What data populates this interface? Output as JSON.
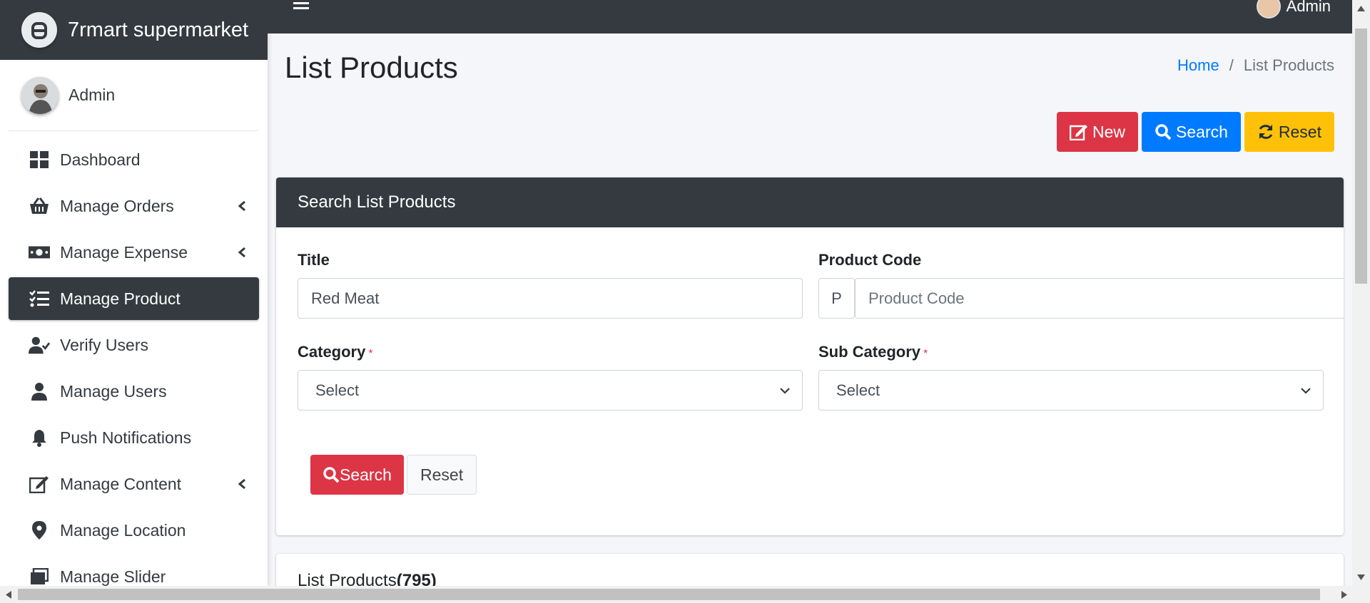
{
  "brand": {
    "name": "7rmart supermarket"
  },
  "sidebar": {
    "user_name": "Admin",
    "items": [
      {
        "label": "Dashboard",
        "icon": "dashboard-icon",
        "has_chevron": false,
        "active": false
      },
      {
        "label": "Manage Orders",
        "icon": "basket-icon",
        "has_chevron": true,
        "active": false
      },
      {
        "label": "Manage Expense",
        "icon": "money-icon",
        "has_chevron": true,
        "active": false
      },
      {
        "label": "Manage Product",
        "icon": "list-check-icon",
        "has_chevron": false,
        "active": true
      },
      {
        "label": "Verify Users",
        "icon": "user-check-icon",
        "has_chevron": false,
        "active": false
      },
      {
        "label": "Manage Users",
        "icon": "user-icon",
        "has_chevron": false,
        "active": false
      },
      {
        "label": "Push Notifications",
        "icon": "bell-icon",
        "has_chevron": false,
        "active": false
      },
      {
        "label": "Manage Content",
        "icon": "edit-icon",
        "has_chevron": true,
        "active": false
      },
      {
        "label": "Manage Location",
        "icon": "map-marker-icon",
        "has_chevron": false,
        "active": false
      },
      {
        "label": "Manage Slider",
        "icon": "slider-icon",
        "has_chevron": false,
        "active": false
      }
    ]
  },
  "topbar": {
    "user_name": "Admin"
  },
  "page": {
    "title": "List Products",
    "breadcrumb": {
      "home": "Home",
      "separator": "/",
      "current": "List Products"
    }
  },
  "actions": {
    "new_label": "New",
    "search_label": "Search",
    "reset_label": "Reset"
  },
  "search_card": {
    "header": "Search List Products",
    "title_label": "Title",
    "title_value": "Red Meat",
    "product_code_label": "Product Code",
    "product_code_prefix": "P",
    "product_code_placeholder": "Product Code",
    "category_label": "Category",
    "category_value": "Select",
    "subcategory_label": "Sub Category",
    "subcategory_value": "Select",
    "required_mark": "*",
    "search_button": "Search",
    "reset_button": "Reset"
  },
  "list_card": {
    "title": "List Products",
    "count": "(795)"
  },
  "colors": {
    "dark": "#343a40",
    "danger": "#dc3545",
    "primary": "#007bff",
    "warning": "#ffc107"
  }
}
